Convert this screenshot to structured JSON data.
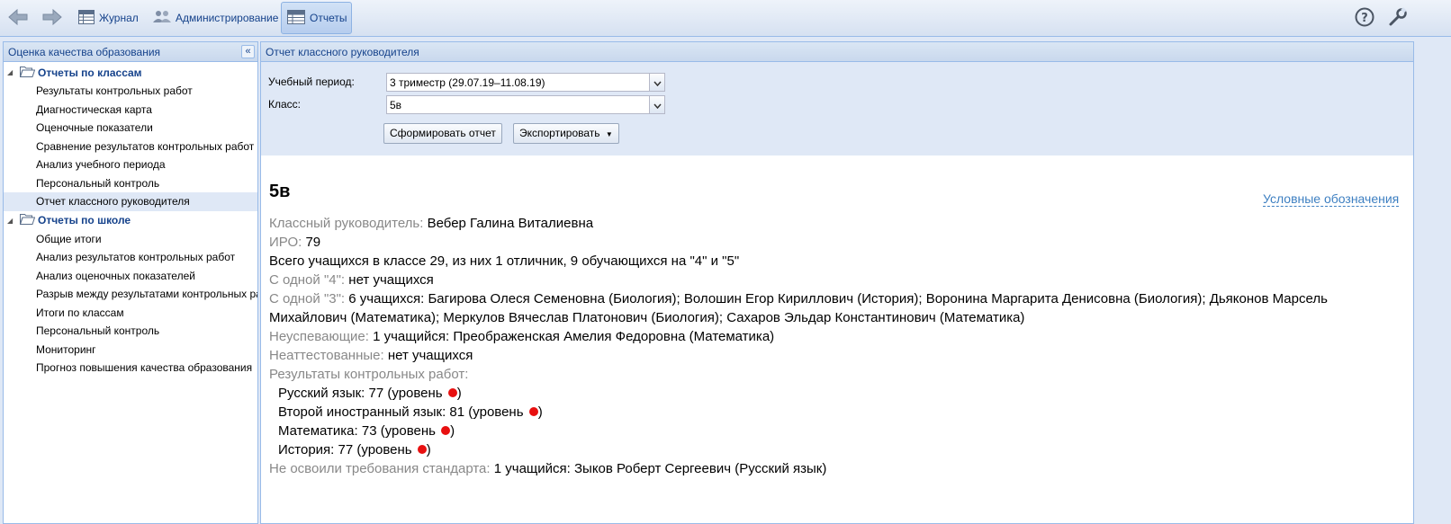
{
  "toolbar": {
    "journal_label": "Журнал",
    "admin_label": "Администрирование",
    "reports_label": "Отчеты"
  },
  "left_panel": {
    "title": "Оценка качества образования",
    "groups": [
      {
        "label": "Отчеты по классам",
        "items": [
          {
            "label": "Результаты контрольных работ"
          },
          {
            "label": "Диагностическая карта"
          },
          {
            "label": "Оценочные показатели"
          },
          {
            "label": "Сравнение результатов контрольных работ"
          },
          {
            "label": "Анализ учебного периода"
          },
          {
            "label": "Персональный контроль"
          },
          {
            "label": "Отчет классного руководителя"
          }
        ]
      },
      {
        "label": "Отчеты по школе",
        "items": [
          {
            "label": "Общие итоги"
          },
          {
            "label": "Анализ результатов контрольных работ"
          },
          {
            "label": "Анализ оценочных показателей"
          },
          {
            "label": "Разрыв между результатами контрольных работ"
          },
          {
            "label": "Итоги по классам"
          },
          {
            "label": "Персональный контроль"
          },
          {
            "label": "Мониторинг"
          },
          {
            "label": "Прогноз повышения качества образования"
          }
        ]
      }
    ]
  },
  "report": {
    "panel_title": "Отчет классного руководителя",
    "period_label": "Учебный период:",
    "period_value": "3 триместр (29.07.19–11.08.19)",
    "class_label": "Класс:",
    "class_value": "5в",
    "generate_button": "Сформировать отчет",
    "export_button": "Экспортировать",
    "legend_link": "Условные обозначения",
    "class_title": "5в",
    "teacher_label": "Классный руководитель:",
    "teacher_value": "Вебер Галина Виталиевна",
    "iro_label": "ИРО:",
    "iro_value": "79",
    "total_text": "Всего учащихся в классе 29, из них 1 отличник, 9 обучающихся на \"4\" и \"5\"",
    "one_four_label": "С одной \"4\":",
    "one_four_value": "нет учащихся",
    "one_three_label": "С одной \"3\":",
    "one_three_value": "6 учащихся: Багирова Олеся Семеновна (Биология); Волошин Егор Кириллович (История); Воронина Маргарита Денисовна (Биология); Дьяконов Марсель Михайлович (Математика); Меркулов Вячеслав Платонович (Биология); Сахаров Эльдар Константинович (Математика)",
    "failing_label": "Неуспевающие:",
    "failing_value": "1 учащийся: Преображенская Амелия Федоровна (Математика)",
    "unattested_label": "Неаттестованные:",
    "unattested_value": "нет учащихся",
    "test_results_label": "Результаты контрольных работ:",
    "test_results": [
      {
        "subject": "Русский язык:",
        "value": "77 (уровень",
        "close": ")",
        "level_color": "#e81010"
      },
      {
        "subject": "Второй иностранный язык:",
        "value": "81 (уровень",
        "close": ")",
        "level_color": "#e81010"
      },
      {
        "subject": "Математика:",
        "value": "73 (уровень",
        "close": ")",
        "level_color": "#e81010"
      },
      {
        "subject": "История:",
        "value": "77 (уровень",
        "close": ")",
        "level_color": "#e81010"
      }
    ],
    "not_mastered_label": "Не освоили требования стандарта:",
    "not_mastered_value": "1 учащийся: Зыков Роберт Сергеевич (Русский язык)"
  },
  "icons": {
    "back": "arrow-left-icon",
    "forward": "arrow-right-icon",
    "journal": "table-icon",
    "admin": "users-icon",
    "reports": "report-icon",
    "help": "help-icon",
    "settings": "wrench-icon"
  },
  "colors": {
    "accent": "#15428b",
    "link": "#3d7fc1",
    "level_red": "#e81010",
    "label_gray": "#888888"
  }
}
